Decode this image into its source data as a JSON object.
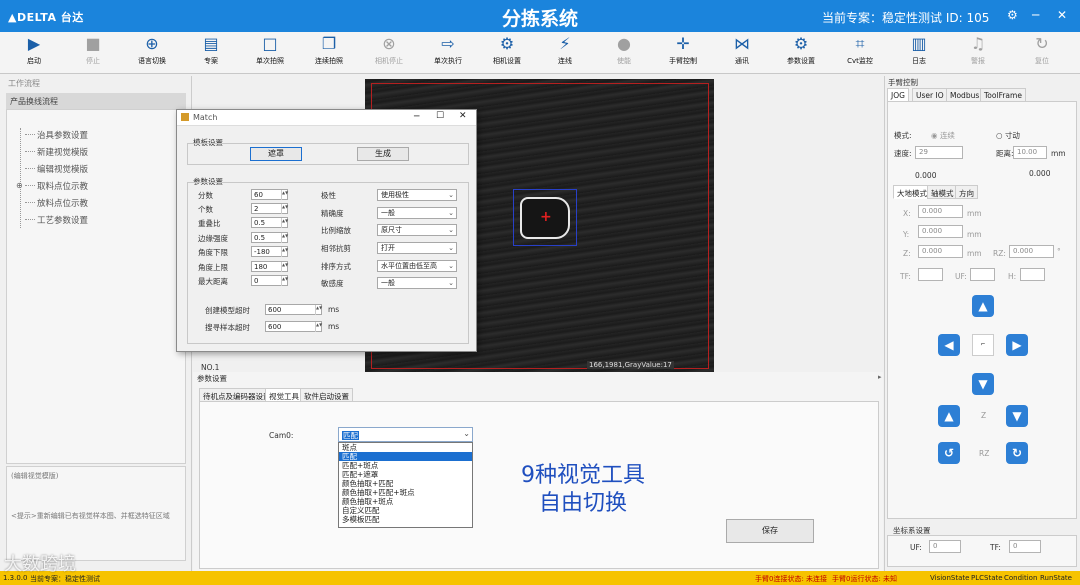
{
  "app": {
    "logo": "▲DELTA 台达",
    "title": "分拣系统",
    "current_project": "当前专案：稳定性测试  ID: 105"
  },
  "toolbar": [
    {
      "label": "启动",
      "icon": "play-icon",
      "glyph": "▶",
      "enabled": true
    },
    {
      "label": "停止",
      "icon": "stop-icon",
      "glyph": "■",
      "enabled": false
    },
    {
      "label": "语言切换",
      "icon": "globe-icon",
      "glyph": "⊕",
      "enabled": true
    },
    {
      "label": "专案",
      "icon": "project-icon",
      "glyph": "▤",
      "enabled": true
    },
    {
      "label": "单次拍照",
      "icon": "single-shot-icon",
      "glyph": "□",
      "enabled": true
    },
    {
      "label": "连续拍照",
      "icon": "continuous-shot-icon",
      "glyph": "❐",
      "enabled": true
    },
    {
      "label": "相机停止",
      "icon": "camera-stop-icon",
      "glyph": "⊗",
      "enabled": false
    },
    {
      "label": "单次执行",
      "icon": "single-run-icon",
      "glyph": "⇨",
      "enabled": true
    },
    {
      "label": "相机设置",
      "icon": "camera-settings-icon",
      "glyph": "⚙",
      "enabled": true
    },
    {
      "label": "连线",
      "icon": "connect-icon",
      "glyph": "⚡",
      "enabled": true
    },
    {
      "label": "使能",
      "icon": "enable-icon",
      "glyph": "●",
      "enabled": false
    },
    {
      "label": "手臂控制",
      "icon": "arm-control-icon",
      "glyph": "✛",
      "enabled": true
    },
    {
      "label": "通讯",
      "icon": "communication-icon",
      "glyph": "⋈",
      "enabled": true
    },
    {
      "label": "参数设置",
      "icon": "parameter-settings-icon",
      "glyph": "⚙",
      "enabled": true
    },
    {
      "label": "Cvt监控",
      "icon": "cvt-monitor-icon",
      "glyph": "⌗",
      "enabled": true
    },
    {
      "label": "日志",
      "icon": "log-icon",
      "glyph": "▥",
      "enabled": true
    },
    {
      "label": "警报",
      "icon": "alarm-icon",
      "glyph": "♫",
      "enabled": false
    },
    {
      "label": "复位",
      "icon": "reset-icon",
      "glyph": "↻",
      "enabled": false
    }
  ],
  "left": {
    "section": "工作流程",
    "tree_header": "产品换线流程",
    "tree_items": [
      "治具参数设置",
      "新建视觉模版",
      "编辑视觉模版",
      "取料点位示教",
      "放料点位示教",
      "工艺参数设置"
    ],
    "edit_box_title": "(编辑视觉模版)",
    "hint": "<提示>重新编辑已有视觉样本图、并框选特征区域"
  },
  "image": {
    "cam_label": "NO.1",
    "readout": "166,1981,GrayValue:17"
  },
  "match_dialog": {
    "title": "Match",
    "template_group": "模板设置",
    "mask_button": "遮罩",
    "generate_button": "生成",
    "param_group": "参数设置",
    "left_params": [
      {
        "label": "分数",
        "value": "60"
      },
      {
        "label": "个数",
        "value": "2"
      },
      {
        "label": "重叠比",
        "value": "0.5"
      },
      {
        "label": "边缘强度",
        "value": "0.5"
      },
      {
        "label": "角度下限",
        "value": "-180"
      },
      {
        "label": "角度上限",
        "value": "180"
      },
      {
        "label": "最大距离",
        "value": "0"
      }
    ],
    "right_params": [
      {
        "label": "极性",
        "value": "使用极性"
      },
      {
        "label": "精确度",
        "value": "一般"
      },
      {
        "label": "比例缩放",
        "value": "原尺寸"
      },
      {
        "label": "相邻抗剪",
        "value": "打开"
      },
      {
        "label": "排序方式",
        "value": "水平位置由低至高"
      },
      {
        "label": "敏感度",
        "value": "一般"
      }
    ],
    "timeouts": [
      {
        "label": "创建模型超时",
        "value": "600",
        "unit": "ms"
      },
      {
        "label": "搜寻样本超时",
        "value": "600",
        "unit": "ms"
      }
    ]
  },
  "bottom": {
    "section": "参数设置",
    "tabs": [
      "待机点及编码器设置",
      "视觉工具",
      "软件启动设置"
    ],
    "cam_label": "Cam0:",
    "selected_tool": "匹配",
    "tool_options": [
      "斑点",
      "匹配",
      "匹配+斑点",
      "匹配+遮罩",
      "颜色抽取+匹配",
      "颜色抽取+匹配+斑点",
      "颜色抽取+斑点",
      "自定义匹配",
      "多模板匹配"
    ],
    "highlighted_option": "匹配",
    "promo_line1": "9种视觉工具",
    "promo_line2": "自由切换",
    "save_button": "保存"
  },
  "right": {
    "section": "手臂控制",
    "tabs": [
      "JOG",
      "User IO",
      "Modbus",
      "ToolFrame"
    ],
    "mode_label": "模式:",
    "mode_continuous": "连续",
    "mode_inch": "寸动",
    "speed_label": "速度:",
    "speed_value": "29",
    "distance_label": "距离:",
    "distance_value": "10.00",
    "distance_unit": "mm",
    "readout_left": "0.000",
    "readout_right": "0.000",
    "subtabs": [
      "大地模式",
      "轴模式",
      "方向"
    ],
    "coords": [
      {
        "label": "X:",
        "value": "0.000",
        "unit": "mm"
      },
      {
        "label": "Y:",
        "value": "0.000",
        "unit": "mm"
      },
      {
        "label": "Z:",
        "value": "0.000",
        "unit": "mm"
      }
    ],
    "rz_label": "RZ:",
    "rz_value": "0.000",
    "rz_unit": "°",
    "tf_label": "TF:",
    "uf_label": "UF:",
    "h_label": "H:",
    "z_label": "Z",
    "rz_center": "RZ",
    "coord_section": "坐标系设置",
    "uf_select_label": "UF:",
    "uf_value": "0",
    "tf_select_label": "TF:",
    "tf_value": "0",
    "color_accent": "#2d7fd5"
  },
  "status": {
    "version": "1.3.0.0",
    "project": "当前专案：稳定性测试",
    "arm0": "手臂0连接状态: 未连接",
    "arm0_run": "手臂0运行状态: 未知",
    "items": [
      "VisionState",
      "PLCState",
      "Condition",
      "RunState"
    ]
  },
  "watermark": "大数跨境"
}
